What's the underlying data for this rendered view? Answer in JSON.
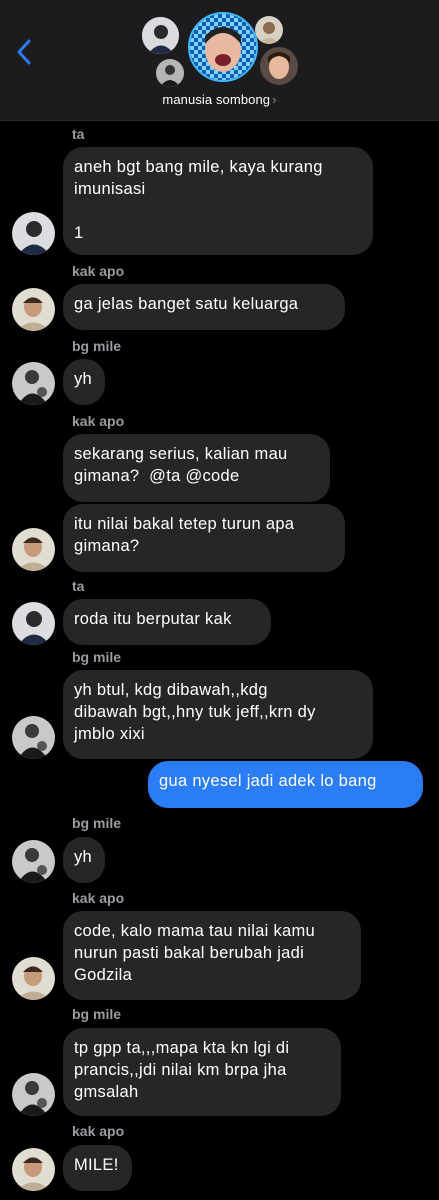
{
  "header": {
    "group_name": "manusia sombong",
    "chevron": "›",
    "back_icon": "chevron-left-icon",
    "accent_color": "#2b7df6"
  },
  "messages": [
    {
      "sender": "ta",
      "text": "aneh bgt bang mile, kaya kurang\nimunisasi\n\n1"
    },
    {
      "sender": "kak apo",
      "text": "ga jelas banget satu keluarga"
    },
    {
      "sender": "bg mile",
      "text": "yh"
    },
    {
      "sender": "kak apo",
      "text": "sekarang serius, kalian mau\ngimana?  @ta @code"
    },
    {
      "sender": "",
      "text": "itu nilai bakal tetep turun apa\ngimana?"
    },
    {
      "sender": "ta",
      "text": "roda itu berputar kak"
    },
    {
      "sender": "bg mile",
      "text": "yh btul, kdg dibawah,,kdg\ndibawah bgt,,hny tuk jeff,,krn dy\njmblo xixi"
    },
    {
      "sender": "me",
      "text": "gua nyesel jadi adek lo bang"
    },
    {
      "sender": "bg mile",
      "text": "yh"
    },
    {
      "sender": "kak apo",
      "text": "code, kalo mama tau nilai kamu\nnurun pasti bakal berubah jadi\nGodzila"
    },
    {
      "sender": "bg mile",
      "text": "tp gpp ta,,,mapa kta kn lgi di\nprancis,,jdi nilai km brpa jha\ngmsalah"
    },
    {
      "sender": "kak apo",
      "text": "MILE!"
    }
  ]
}
